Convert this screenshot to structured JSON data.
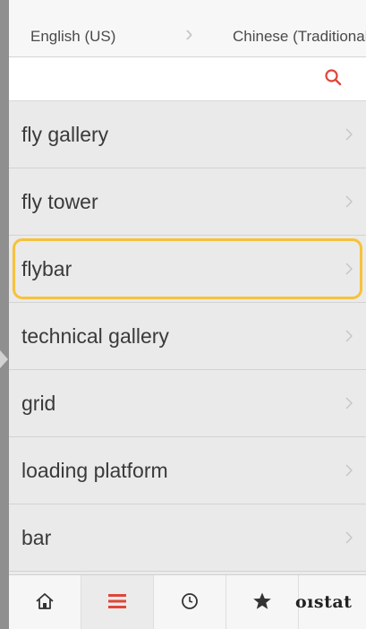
{
  "language_bar": {
    "source_language": "English (US)",
    "target_language": "Chinese (Traditional)"
  },
  "search": {
    "value": "",
    "placeholder": ""
  },
  "term_list": {
    "items": [
      {
        "label": "fly gallery"
      },
      {
        "label": "fly tower"
      },
      {
        "label": "flybar",
        "selected": true
      },
      {
        "label": "technical gallery"
      },
      {
        "label": "grid"
      },
      {
        "label": "loading platform"
      },
      {
        "label": "bar"
      }
    ]
  },
  "tab_bar": {
    "tabs": [
      {
        "icon": "home-icon"
      },
      {
        "icon": "list-icon",
        "active": true
      },
      {
        "icon": "clock-icon"
      },
      {
        "icon": "star-icon"
      }
    ],
    "brand": "oıstat"
  },
  "colors": {
    "accent": "#e0453a",
    "selection_outline": "#f6c23c",
    "list_background": "#eaeaea"
  }
}
